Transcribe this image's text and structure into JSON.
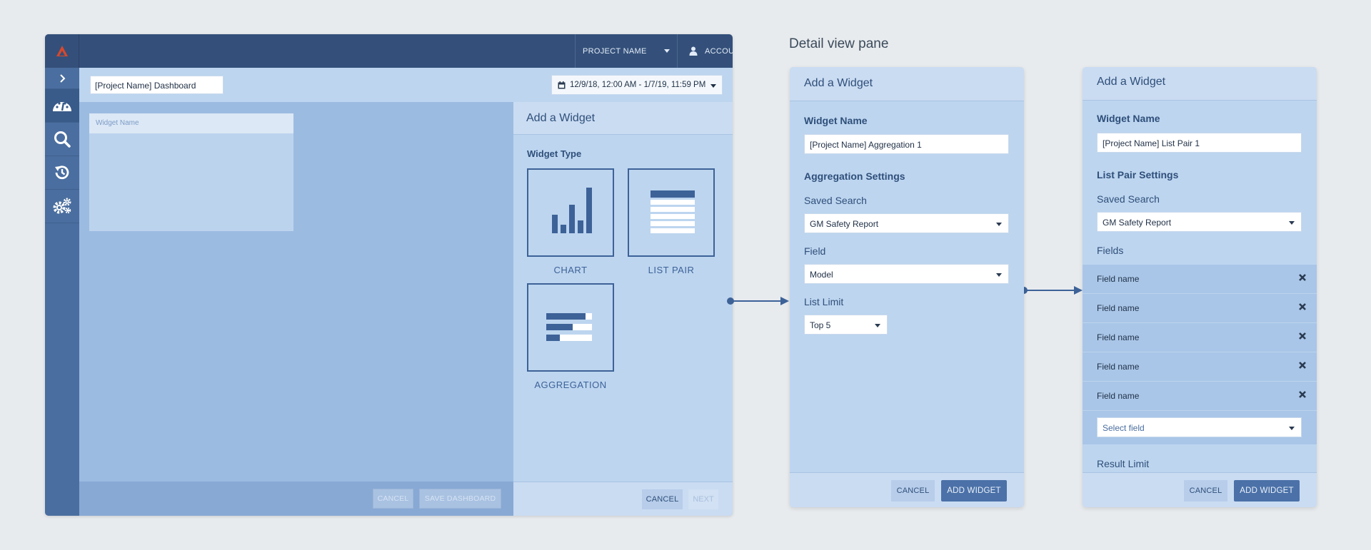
{
  "app": {
    "topbar": {
      "project_label": "PROJECT NAME",
      "account_label": "ACCOUNT"
    },
    "dashboard_name": "[Project Name] Dashboard",
    "date_range": "12/9/18, 12:00 AM - 1/7/19, 11:59 PM",
    "widget_card_title": "Widget Name",
    "footer": {
      "cancel_label": "CANCEL",
      "save_label": "SAVE DASHBOARD"
    },
    "add_widget_pane": {
      "title": "Add a Widget",
      "widget_type_label": "Widget Type",
      "types": [
        "CHART",
        "LIST PAIR",
        "AGGREGATION"
      ],
      "cancel_label": "CANCEL",
      "next_label": "NEXT"
    }
  },
  "detail_title": "Detail view pane",
  "aggregation_panel": {
    "title": "Add a Widget",
    "widget_name_label": "Widget Name",
    "widget_name_value": "[Project Name] Aggregation 1",
    "settings_label": "Aggregation Settings",
    "saved_search_label": "Saved Search",
    "saved_search_value": "GM Safety Report",
    "field_label": "Field",
    "field_value": "Model",
    "list_limit_label": "List Limit",
    "list_limit_value": "Top 5",
    "cancel_label": "CANCEL",
    "add_label": "ADD WIDGET"
  },
  "list_pair_panel": {
    "title": "Add a Widget",
    "widget_name_label": "Widget Name",
    "widget_name_value": "[Project Name] List Pair 1",
    "settings_label": "List Pair Settings",
    "saved_search_label": "Saved Search",
    "saved_search_value": "GM Safety Report",
    "fields_label": "Fields",
    "fields": [
      "Field name",
      "Field name",
      "Field name",
      "Field name",
      "Field name"
    ],
    "select_field_placeholder": "Select field",
    "result_limit_label": "Result Limit",
    "cancel_label": "CANCEL",
    "add_label": "ADD WIDGET"
  },
  "colors": {
    "navy": "#34507a",
    "accent": "#4b71a8",
    "logo": "#d9482b"
  },
  "icons": [
    "logo-icon",
    "chevron-right-icon",
    "dashboard-gauge-icon",
    "search-icon",
    "history-icon",
    "settings-gears-icon",
    "user-icon",
    "calendar-icon",
    "close-icon"
  ]
}
